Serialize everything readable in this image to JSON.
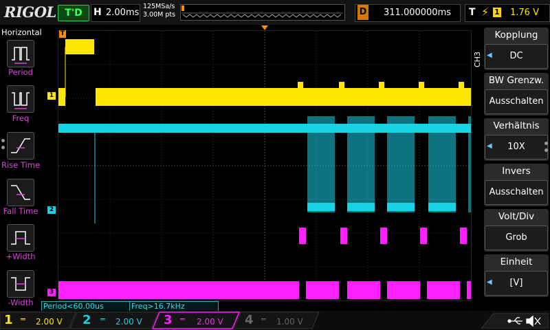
{
  "topbar": {
    "logo": "RIGOL",
    "trigger_state": "T'D",
    "timebase_label": "H",
    "timebase_value": "2.00ms",
    "sample_rate": "125MSa/s",
    "memory_depth": "3.00M pts",
    "delay_label": "D",
    "delay_value": "311.000000ms",
    "trigger_label": "T",
    "trigger_source": "1",
    "trigger_level": "1.76 V"
  },
  "left_panel": {
    "title": "Horizontal",
    "items": [
      {
        "label": "Period",
        "icon": "period-icon"
      },
      {
        "label": "Freq",
        "icon": "frequency-icon"
      },
      {
        "label": "Rise Time",
        "icon": "rise-time-icon"
      },
      {
        "label": "Fall Time",
        "icon": "fall-time-icon"
      },
      {
        "label": "+Width",
        "icon": "positive-width-icon"
      },
      {
        "label": "-Width",
        "icon": "negative-width-icon"
      }
    ]
  },
  "right_panel": {
    "channel": "CH3",
    "menus": [
      {
        "title": "Kopplung",
        "value": "DC",
        "arrow": true
      },
      {
        "title": "BW Grenzw.",
        "value": "Ausschalten",
        "arrow": false
      },
      {
        "title": "Verhältnis",
        "value": "10X",
        "arrow": true
      },
      {
        "title": "Invers",
        "value": "Ausschalten",
        "arrow": false
      },
      {
        "title": "Volt/Div",
        "value": "Grob",
        "arrow": false
      },
      {
        "title": "Einheit",
        "value": "[V]",
        "arrow": true
      }
    ]
  },
  "measurements": {
    "period": "Period<60.00us",
    "freq": "Freq>16.7kHz"
  },
  "channels": [
    {
      "num": "1",
      "scale": "2.00 V",
      "color": "#ffe600"
    },
    {
      "num": "2",
      "scale": "2.00 V",
      "color": "#19d2e6"
    },
    {
      "num": "3",
      "scale": "2.00 V",
      "color": "#ff20ff"
    },
    {
      "num": "4",
      "scale": "1.00 V",
      "color": "#555555"
    }
  ],
  "colors": {
    "ch1": "#ffe600",
    "ch2": "#19d2e6",
    "ch3": "#ff20ff",
    "trigger_marker": "#ff8c00",
    "grid": "#3a3a3a"
  },
  "icons": {
    "usb": "usb-icon",
    "speaker": "speaker-mute-icon"
  }
}
